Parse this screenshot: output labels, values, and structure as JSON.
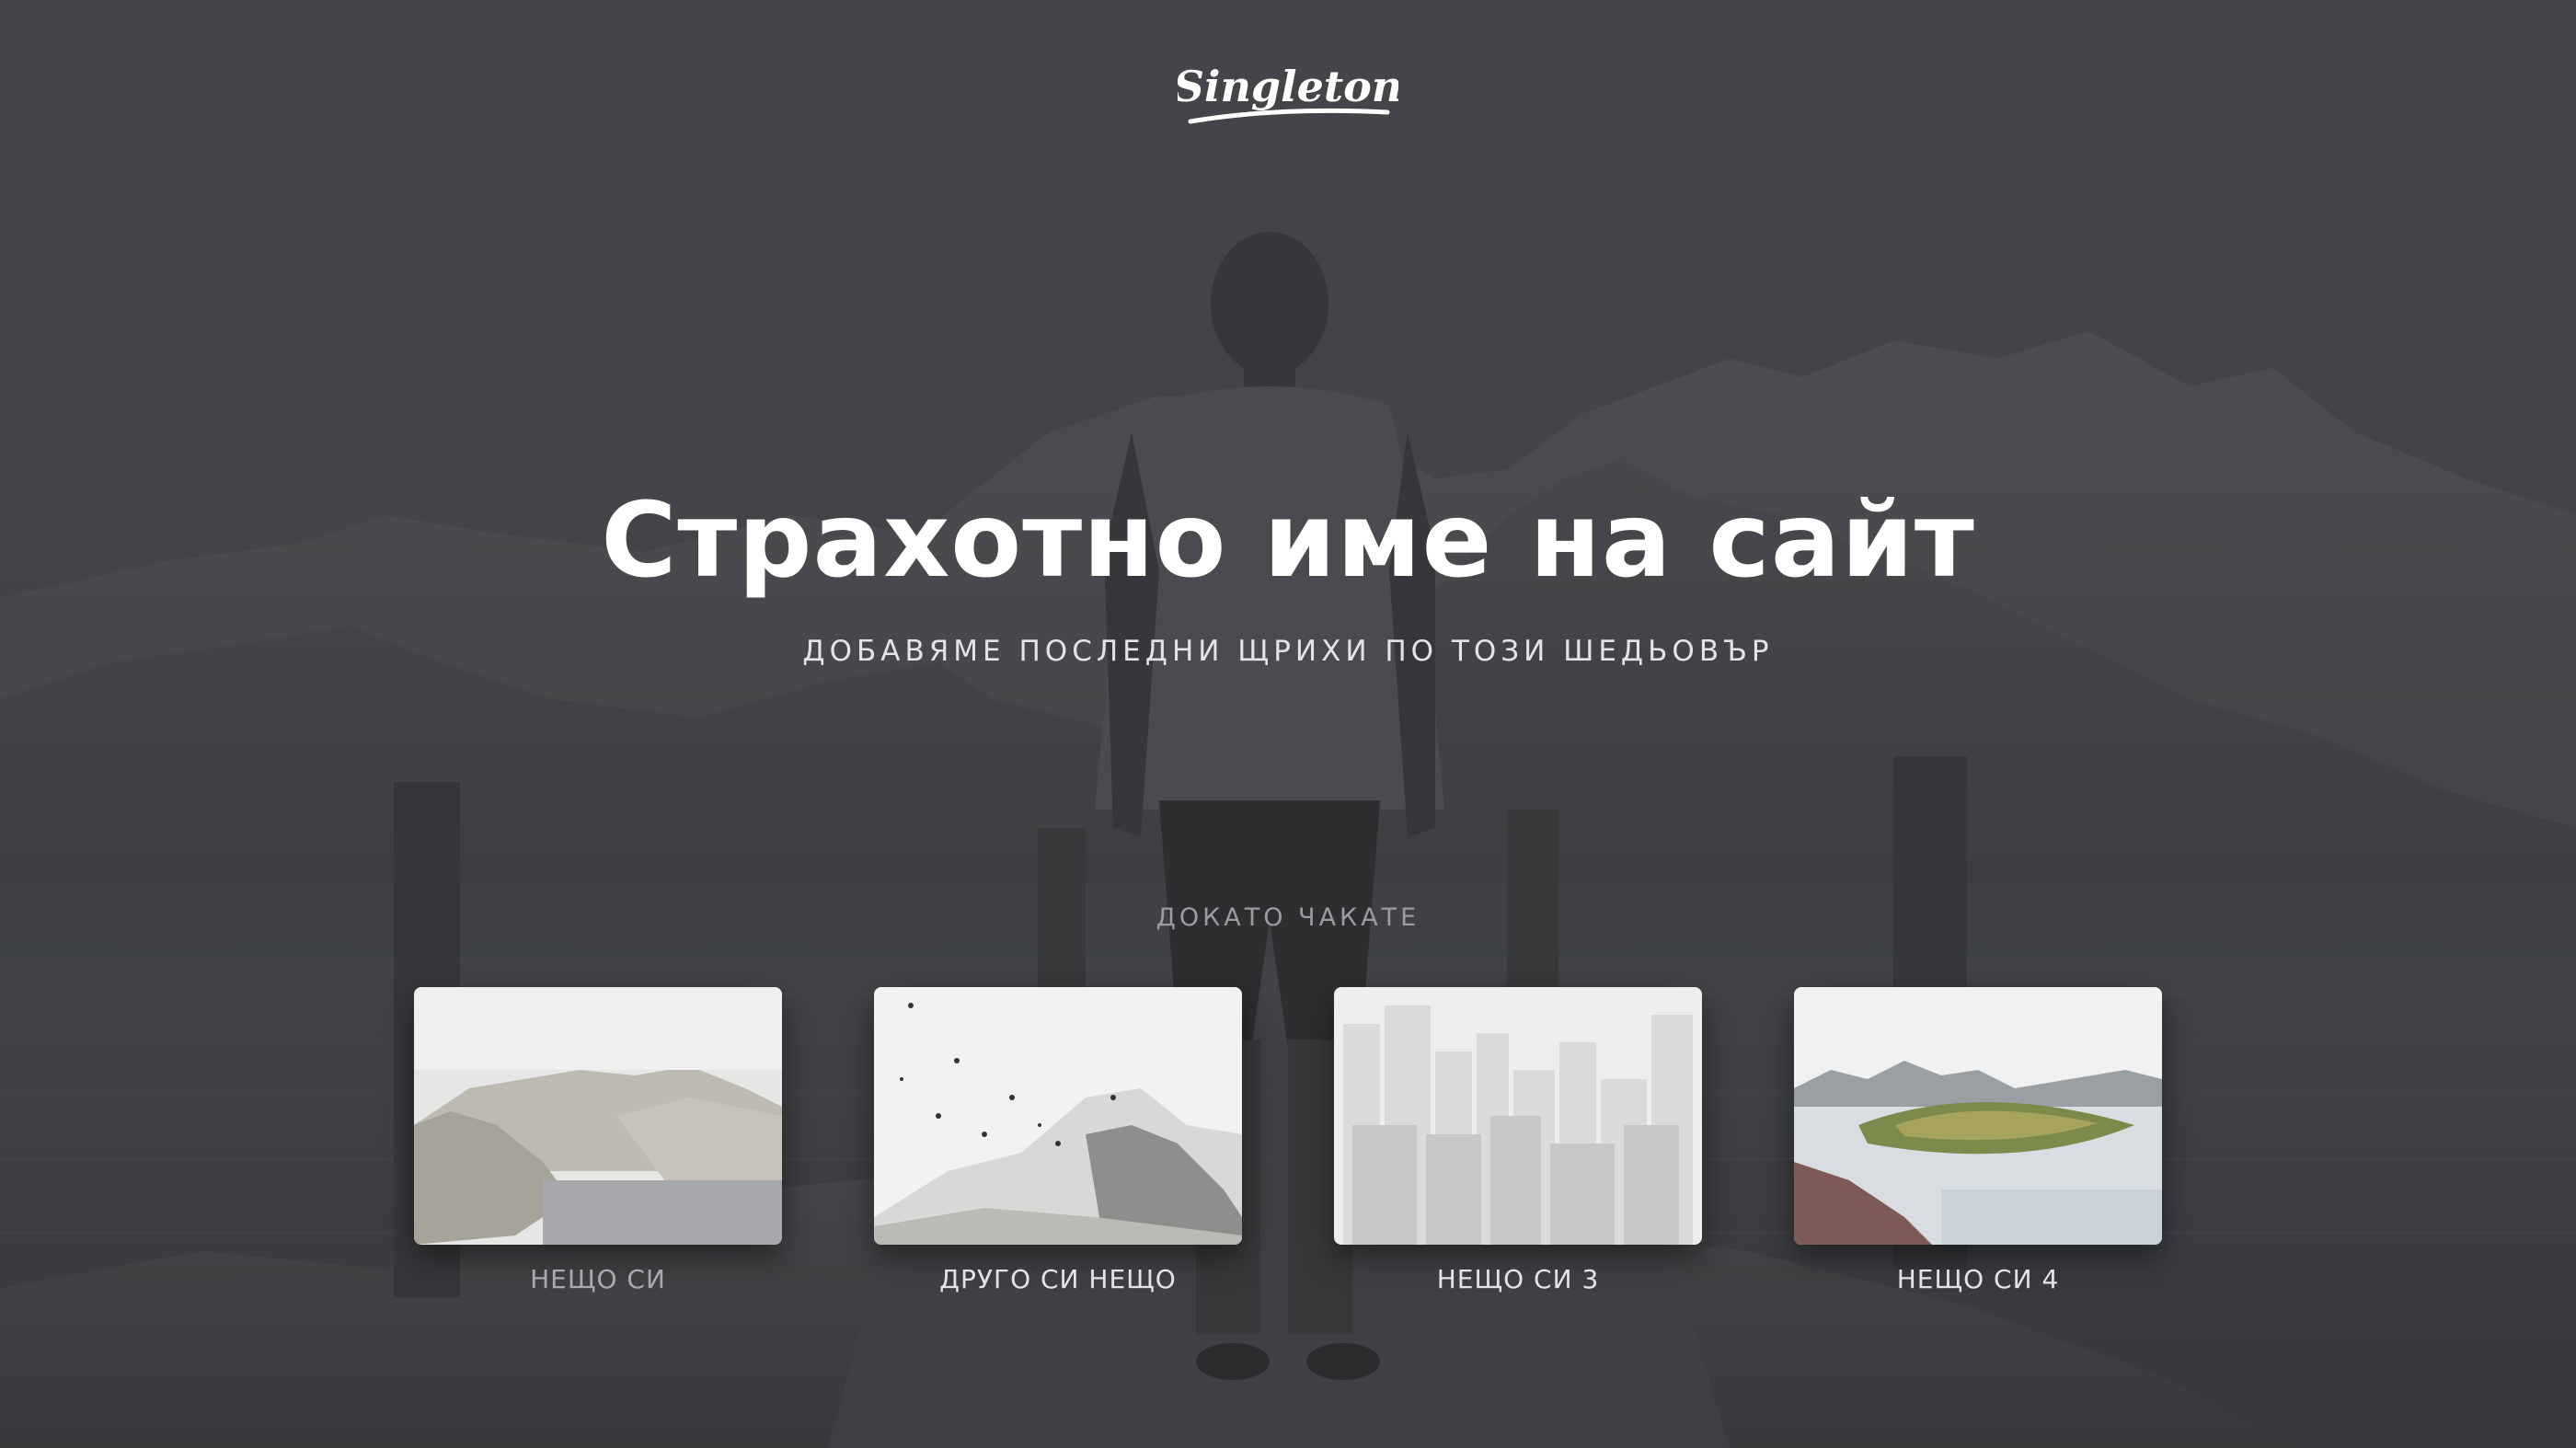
{
  "brand": {
    "logo_text": "Singleton"
  },
  "hero": {
    "title": "Страхотно име на сайт",
    "subtitle": "ДОБАВЯМЕ ПОСЛЕДНИ ЩРИХИ ПО ТОЗИ ШЕДЬОВЪР"
  },
  "links": {
    "heading": "ДОКАТО ЧАКАТЕ",
    "items": [
      {
        "label": "НЕЩО СИ"
      },
      {
        "label": "ДРУГО СИ НЕЩО"
      },
      {
        "label": "НЕЩО СИ 3"
      },
      {
        "label": "НЕЩО СИ 4"
      }
    ]
  },
  "colors": {
    "text_primary": "#ffffff",
    "text_secondary": "#e4e4e6",
    "text_muted": "#9a9ca0",
    "overlay": "#45474a"
  }
}
